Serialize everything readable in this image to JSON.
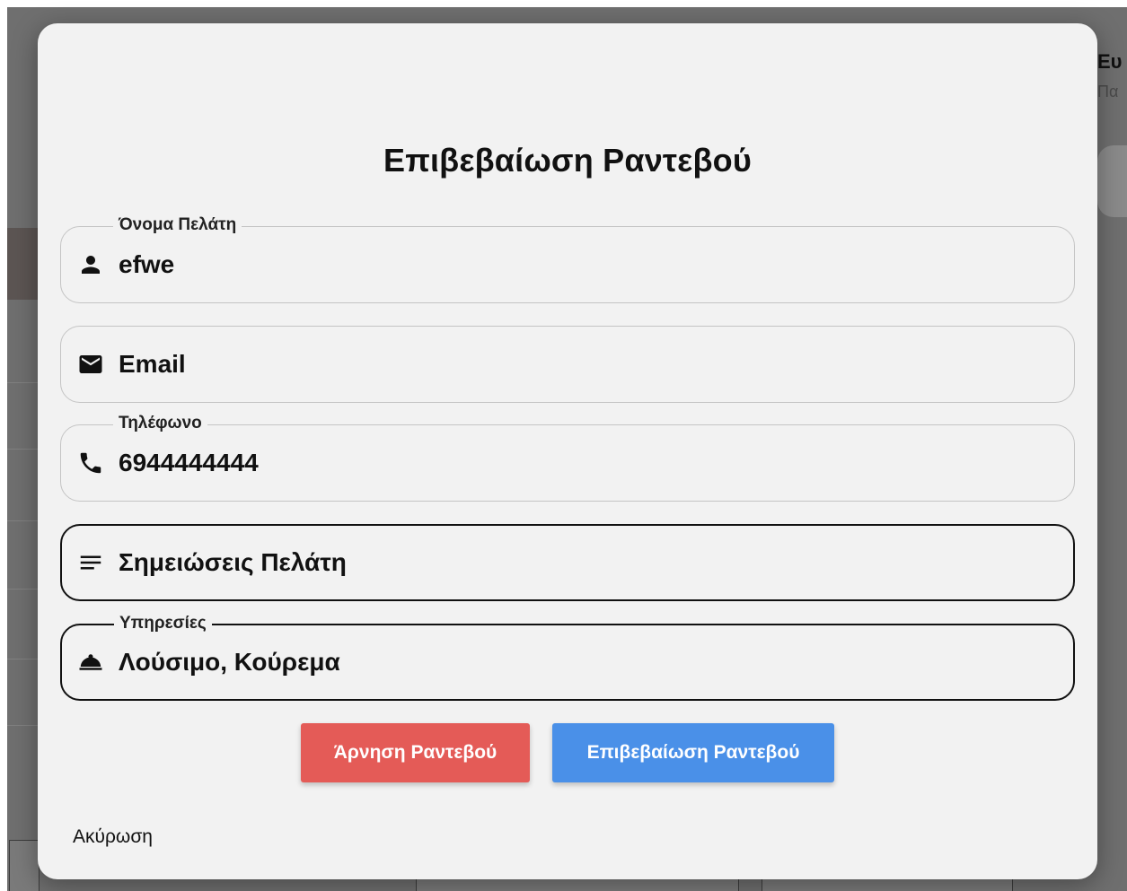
{
  "background": {
    "right_title": "Ευ",
    "right_subtitle": "Πα"
  },
  "modal": {
    "title": "Επιβεβαίωση Ραντεβού",
    "fields": {
      "name": {
        "label": "Όνομα Πελάτη",
        "value": "efwe",
        "icon": "person-icon"
      },
      "email": {
        "placeholder": "Email",
        "value": "",
        "icon": "mail-icon"
      },
      "phone": {
        "label": "Τηλέφωνο",
        "value": "6944444444",
        "icon": "phone-icon"
      },
      "notes": {
        "placeholder": "Σημειώσεις Πελάτη",
        "value": "",
        "icon": "notes-icon"
      },
      "services": {
        "label": "Υπηρεσίες",
        "value": "Λούσιμο, Κούρεμα",
        "icon": "room-service-icon"
      }
    },
    "buttons": {
      "deny": "Άρνηση Ραντεβού",
      "confirm": "Επιβεβαίωση Ραντεβού"
    },
    "cancel": "Ακύρωση"
  },
  "colors": {
    "deny": "#e45b57",
    "confirm": "#4a90e8",
    "modal_bg": "#f2f2f2"
  }
}
